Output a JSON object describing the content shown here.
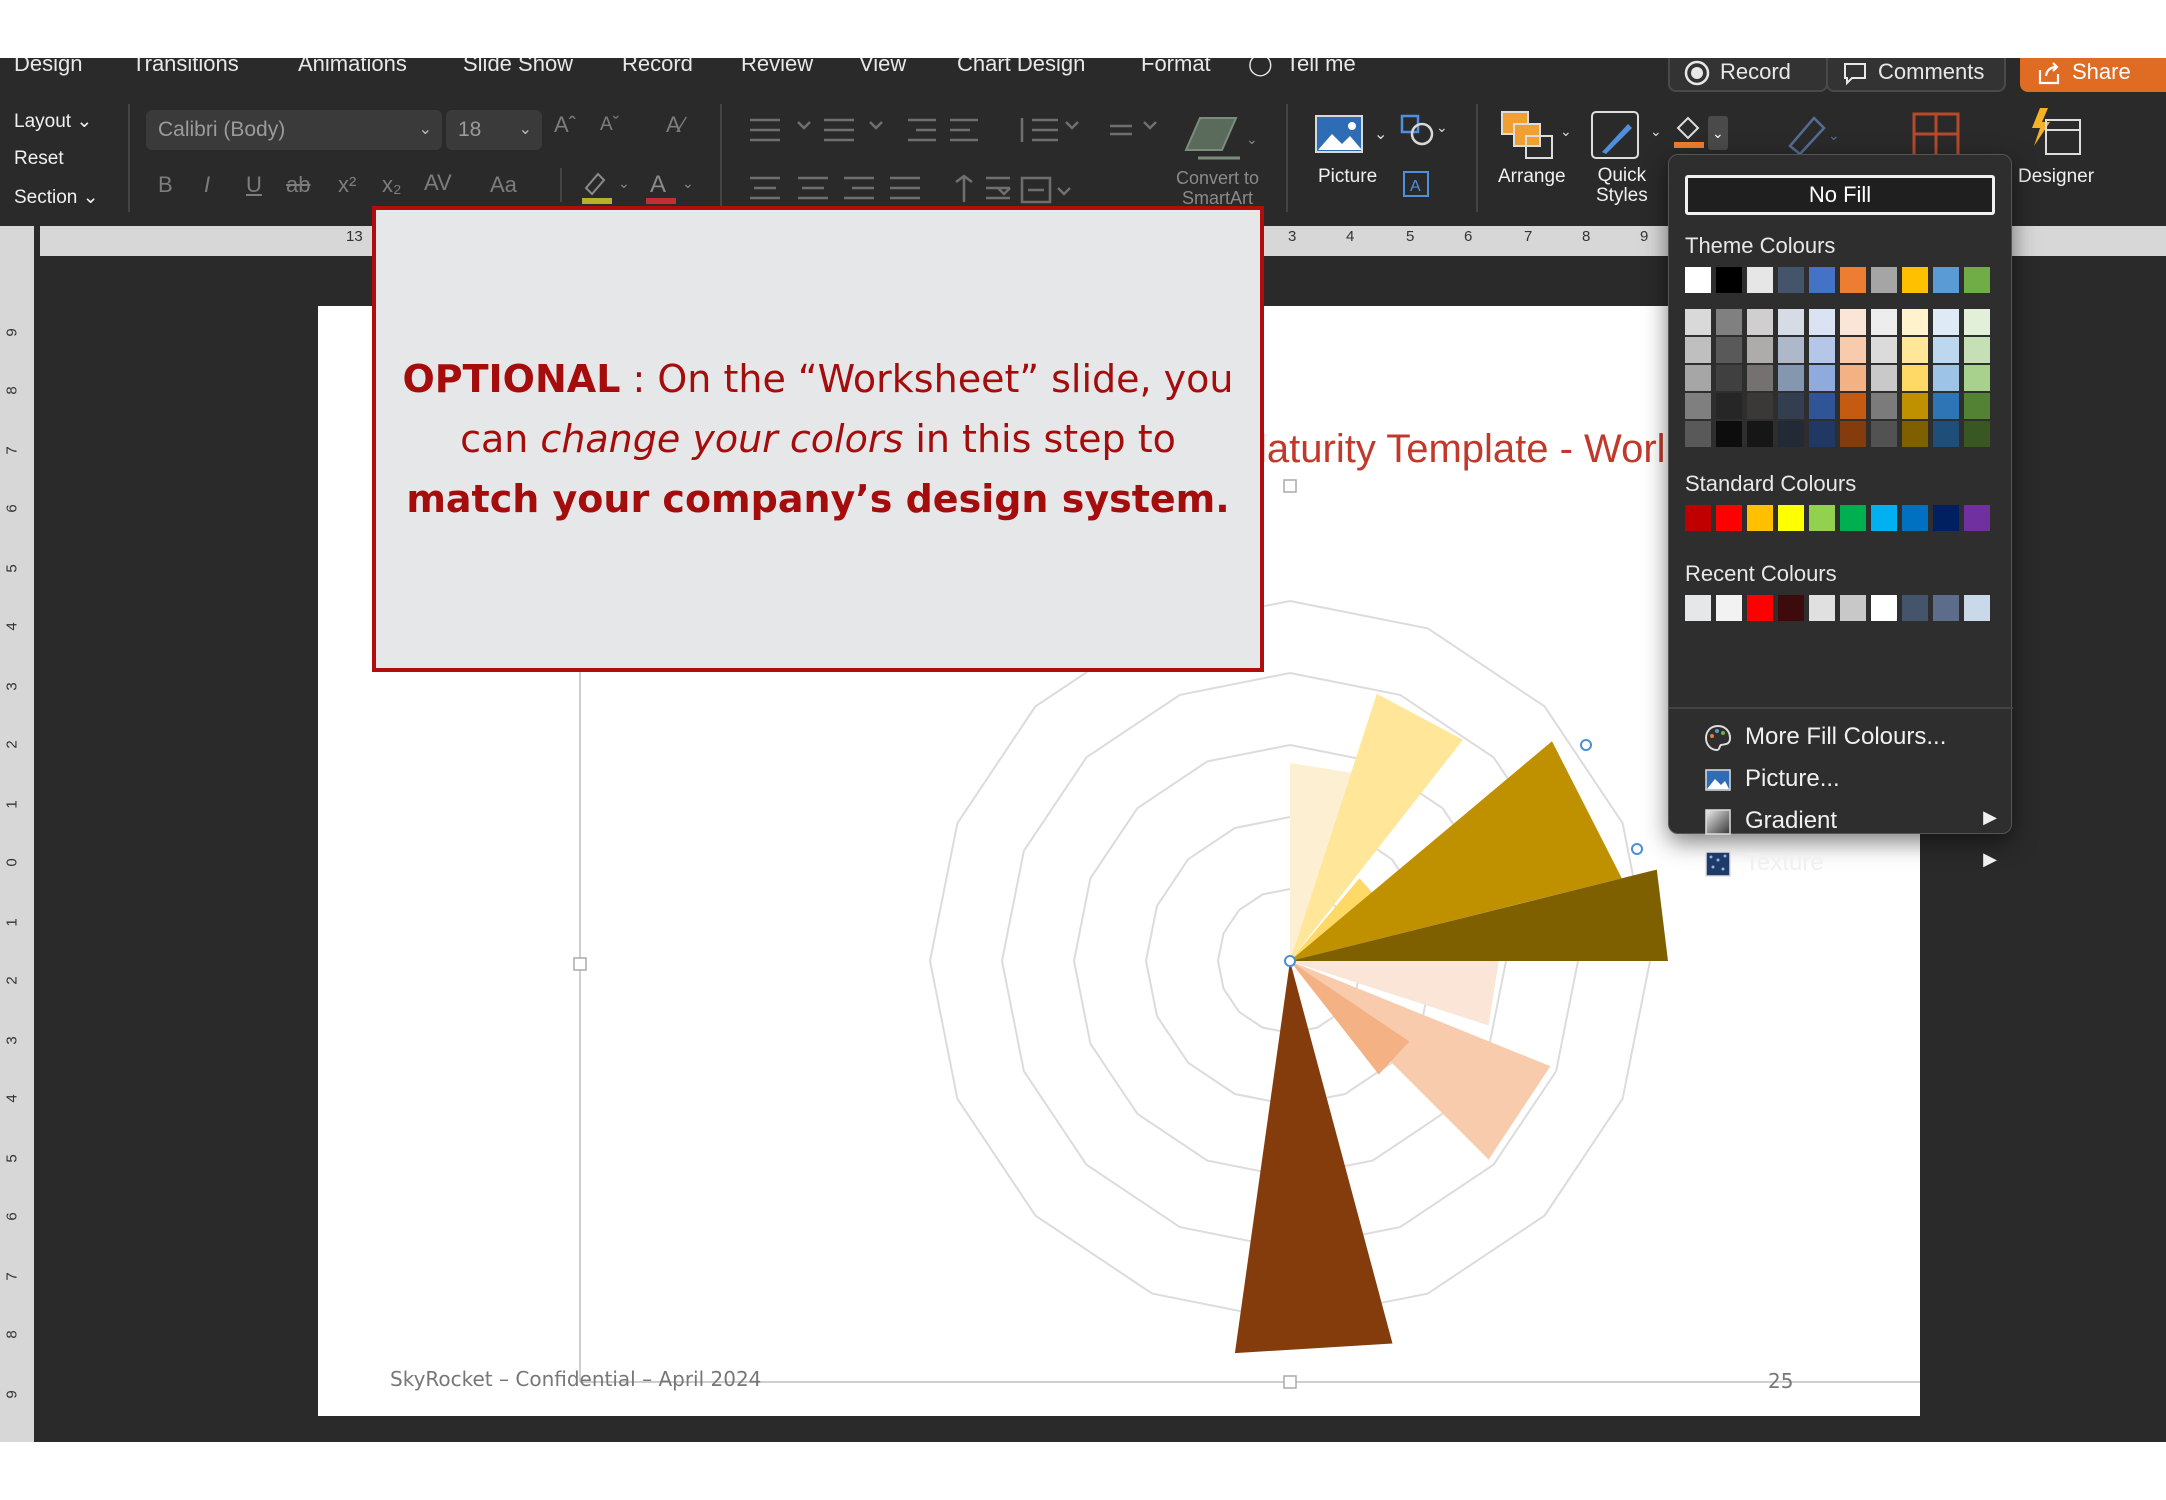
{
  "tabs": [
    "Design",
    "Transitions",
    "Animations",
    "Slide Show",
    "Record",
    "Review",
    "View",
    "Chart Design",
    "Format",
    "Tell me"
  ],
  "top_buttons": {
    "record": "Record",
    "comments": "Comments",
    "share": "Share"
  },
  "ribbon": {
    "slides_group": {
      "layout": "Layout",
      "reset": "Reset",
      "section": "Section"
    },
    "font_name": "Calibri (Body)",
    "font_size": "18",
    "font_format_glyphs": [
      "B",
      "I",
      "U",
      "ab",
      "x²",
      "x₂",
      "AV",
      "Aa"
    ],
    "convert_smartart": [
      "Convert to",
      "SmartArt"
    ],
    "picture": "Picture",
    "arrange": "Arrange",
    "quick_styles": [
      "Quick",
      "Styles"
    ],
    "designer": "Designer"
  },
  "rulers": {
    "horizontal": [
      "13",
      "3",
      "4",
      "5",
      "6",
      "7",
      "8",
      "9"
    ],
    "vertical": [
      "9",
      "8",
      "7",
      "6",
      "5",
      "4",
      "3",
      "2",
      "1",
      "0",
      "1",
      "2",
      "3",
      "4",
      "5",
      "6",
      "7",
      "8",
      "9"
    ]
  },
  "slide": {
    "title_partial": "laturity Template - Worl",
    "footer": "SkyRocket – Confidential – April 2024",
    "page_number": "25"
  },
  "callout": {
    "optional": "OPTIONAL",
    "part1": " : On the “Worksheet” slide, you can ",
    "italic": "change your colors",
    "part2": " in this step to ",
    "bold_end": "match your company’s design system."
  },
  "fill_menu": {
    "no_fill": "No Fill",
    "theme_heading": "Theme Colours",
    "theme_top": [
      "#ffffff",
      "#000000",
      "#e7e6e6",
      "#44546a",
      "#4472c4",
      "#ed7d31",
      "#a5a5a5",
      "#ffc000",
      "#5b9bd5",
      "#70ad47"
    ],
    "theme_shades": [
      [
        "#d9d9d9",
        "#bfbfbf",
        "#a6a6a6",
        "#7f7f7f",
        "#595959"
      ],
      [
        "#808080",
        "#595959",
        "#404040",
        "#262626",
        "#0d0d0d"
      ],
      [
        "#d0cece",
        "#aeabab",
        "#757171",
        "#3b3838",
        "#171616"
      ],
      [
        "#d6dce5",
        "#adb9ca",
        "#8497b0",
        "#333f50",
        "#222a35"
      ],
      [
        "#dae3f3",
        "#b4c7e7",
        "#8faadc",
        "#2f5597",
        "#203864"
      ],
      [
        "#fbe5d6",
        "#f8cbad",
        "#f4b183",
        "#c55a11",
        "#843c0c"
      ],
      [
        "#ededed",
        "#dbdbdb",
        "#c9c9c9",
        "#7b7b7b",
        "#525252"
      ],
      [
        "#fff2cc",
        "#ffe699",
        "#ffd966",
        "#bf9000",
        "#7f6000"
      ],
      [
        "#deebf7",
        "#bdd7ee",
        "#9dc3e6",
        "#2e75b6",
        "#1f4e79"
      ],
      [
        "#e2f0d9",
        "#c5e0b4",
        "#a9d18e",
        "#548235",
        "#385723"
      ]
    ],
    "standard_heading": "Standard Colours",
    "standard": [
      "#c00000",
      "#ff0000",
      "#ffc000",
      "#ffff00",
      "#92d050",
      "#00b050",
      "#00b0f0",
      "#0070c0",
      "#002060",
      "#7030a0"
    ],
    "recent_heading": "Recent Colours",
    "recent": [
      "#e6e7e9",
      "#f2f2f2",
      "#ff0000",
      "#3d0b0b",
      "#e0e0e0",
      "#c8c8c8",
      "#ffffff",
      "#44546a",
      "#5b6d8a",
      "#c9d9ea"
    ],
    "items": [
      {
        "label": "More Fill Colours...",
        "icon": "palette-icon",
        "submenu": false
      },
      {
        "label": "Picture...",
        "icon": "picture-icon",
        "submenu": false
      },
      {
        "label": "Gradient",
        "icon": "gradient-icon",
        "submenu": true
      },
      {
        "label": "Texture",
        "icon": "texture-icon",
        "submenu": true
      }
    ]
  },
  "colors": {
    "accent_red": "#b10d0d",
    "share_orange": "#e06b23",
    "app_bg": "#2a2a2a"
  },
  "chart_data": {
    "type": "polar-area",
    "rings": 5,
    "spokes": 16,
    "wedges": [
      {
        "direction": "up",
        "radius": 0.55,
        "color": "#fdf0d2"
      },
      {
        "direction": "up-right",
        "radius": 0.78,
        "color": "#ffe699"
      },
      {
        "direction": "up-right",
        "radius": 0.3,
        "color": "#ffd966"
      },
      {
        "direction": "right-up",
        "radius": 0.95,
        "color": "#bf9000"
      },
      {
        "direction": "right",
        "radius": 1.05,
        "color": "#7f6000"
      },
      {
        "direction": "right-down",
        "radius": 0.58,
        "color": "#fbe5d6"
      },
      {
        "direction": "down-right",
        "radius": 0.78,
        "color": "#f8cbad"
      },
      {
        "direction": "down-right",
        "radius": 0.4,
        "color": "#f4b183"
      },
      {
        "direction": "down",
        "radius": 0.12,
        "color": "#c55a11"
      },
      {
        "direction": "down",
        "radius": 1.1,
        "color": "#843c0c"
      }
    ]
  }
}
